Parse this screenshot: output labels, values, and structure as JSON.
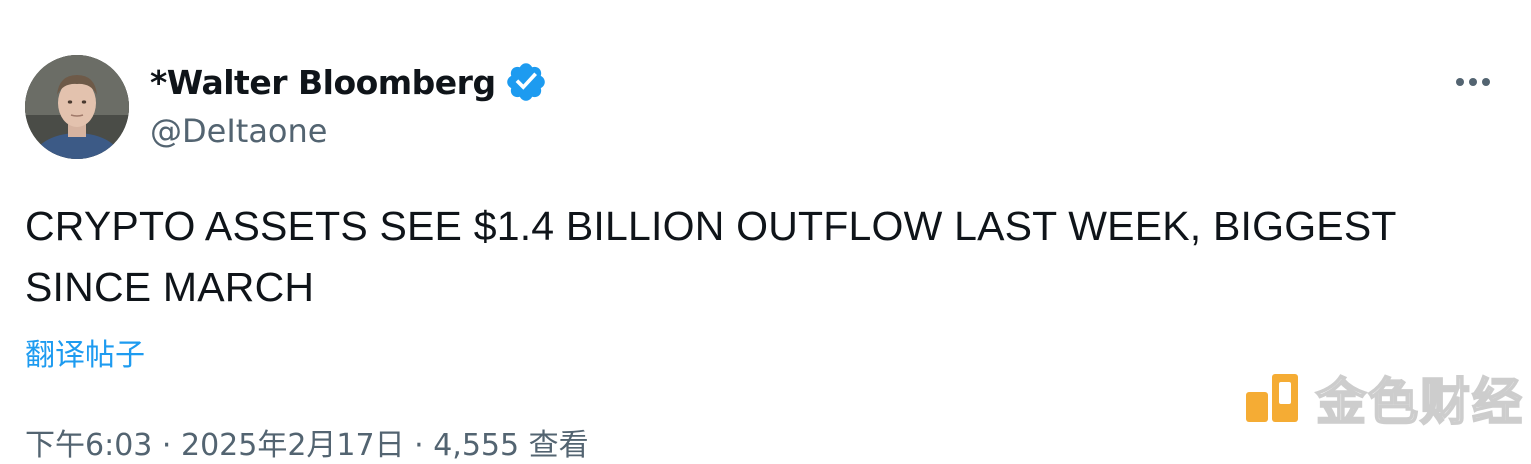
{
  "author": {
    "display_name": "*Walter Bloomberg",
    "handle": "@DeItaone",
    "verified": true,
    "avatar_icon": "person-avatar"
  },
  "post": {
    "text": "CRYPTO ASSETS SEE $1.4 BILLION OUTFLOW LAST WEEK, BIGGEST SINCE MARCH",
    "translate_label": "翻译帖子",
    "meta": "下午6:03 · 2025年2月17日 · 4,555 查看"
  },
  "menu": {
    "more_icon": "more-horizontal-icon"
  },
  "watermark": {
    "text": "金色财经",
    "logo_icon": "jinse-logo-icon"
  },
  "colors": {
    "accent": "#1d9bf0",
    "secondary_text": "#536471",
    "primary_text": "#0f1419",
    "watermark_orange": "#f5a623"
  }
}
